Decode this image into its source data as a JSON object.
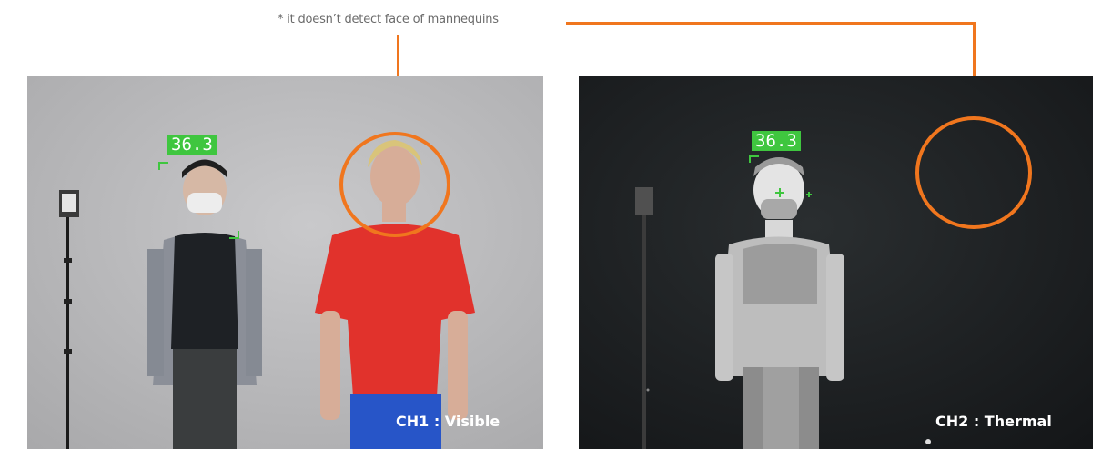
{
  "annotation": {
    "note": "* it doesn’t detect face of mannequins"
  },
  "colors": {
    "accent_orange": "#f0761e",
    "detection_green": "#3fc63f"
  },
  "ch1": {
    "caption": "CH1 : Visible",
    "temperature": "36.3"
  },
  "ch2": {
    "caption": "CH2 : Thermal",
    "temperature": "36.3"
  }
}
